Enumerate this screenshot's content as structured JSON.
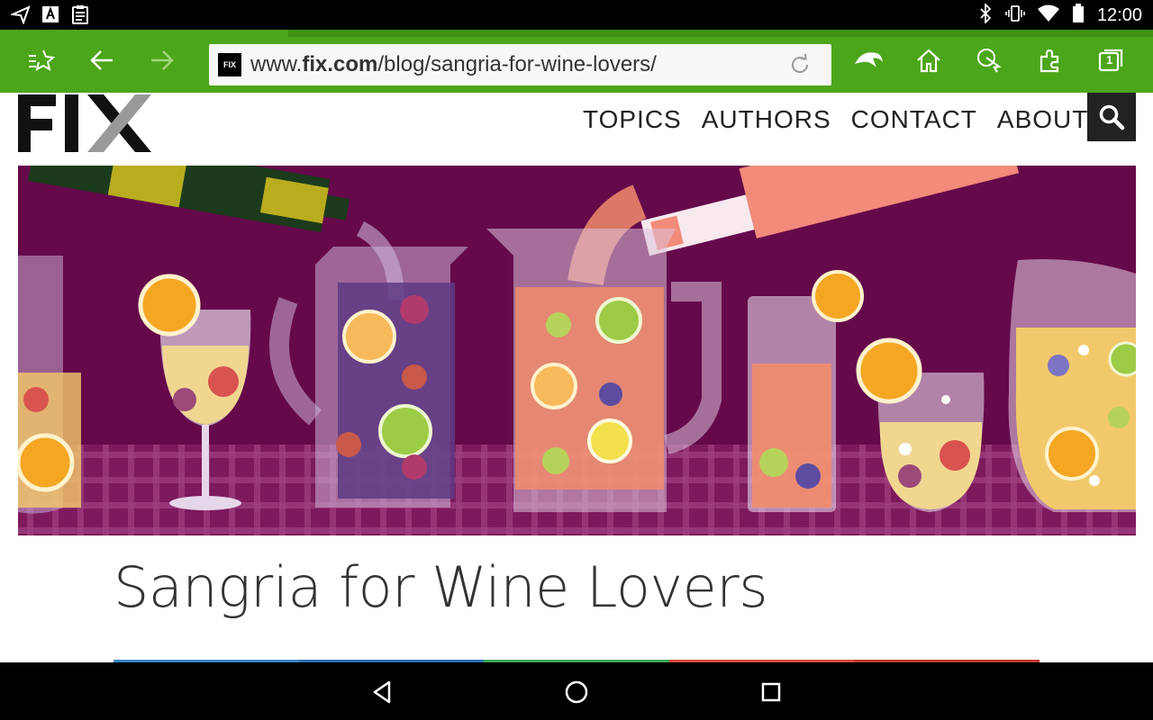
{
  "status_bar": {
    "time": "12:00",
    "left_icons": [
      "send-icon",
      "font-icon",
      "clipboard-icon"
    ],
    "right_icons": [
      "bluetooth-icon",
      "vibrate-icon",
      "wifi-icon",
      "battery-icon"
    ]
  },
  "browser": {
    "url_prefix": "www.",
    "url_domain": "fix.com",
    "url_path": "/blog/sangria-for-wine-lovers/",
    "favicon_text": "FIX",
    "tab_count": "1",
    "toolbar_color": "#4ca619"
  },
  "site": {
    "logo_text": "FIX",
    "nav": [
      "TOPICS",
      "AUTHORS",
      "CONTACT",
      "ABOUT"
    ]
  },
  "article": {
    "title": "Sangria for Wine Lovers",
    "share_colors": [
      "#3b82c4",
      "#2e6fb0",
      "#3aa655",
      "#d64a3b",
      "#c0392b"
    ]
  },
  "hero": {
    "background": "#6a0b4e",
    "tablecloth": "#8a2a6c"
  }
}
